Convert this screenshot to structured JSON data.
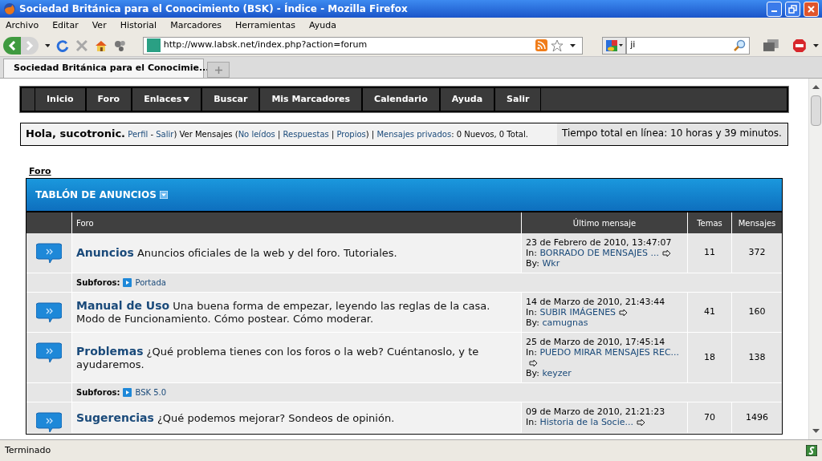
{
  "window": {
    "title": "Sociedad Británica para el Conocimiento (BSK) - Índice - Mozilla Firefox"
  },
  "menu": [
    "Archivo",
    "Editar",
    "Ver",
    "Historial",
    "Marcadores",
    "Herramientas",
    "Ayuda"
  ],
  "address": {
    "value": "http://www.labsk.net/index.php?action=forum"
  },
  "search": {
    "value": "ji"
  },
  "tabs": [
    {
      "label": "Sociedad Británica para el Conocimie...",
      "selected": true
    }
  ],
  "nav": [
    {
      "label": "Inicio",
      "has_menu": false
    },
    {
      "label": "Foro",
      "has_menu": false
    },
    {
      "label": "Enlaces",
      "has_menu": true
    },
    {
      "label": "Buscar",
      "has_menu": false
    },
    {
      "label": "Mis Marcadores",
      "has_menu": false
    },
    {
      "label": "Calendario",
      "has_menu": false
    },
    {
      "label": "Ayuda",
      "has_menu": false
    },
    {
      "label": "Salir",
      "has_menu": false
    }
  ],
  "user_box": {
    "greeting": "Hola, sucotronic.",
    "links_before": [
      {
        "text": "Perfil",
        "kind": "link"
      },
      {
        "text": " - ",
        "kind": "text"
      },
      {
        "text": "Salir",
        "kind": "link"
      },
      {
        "text": ") Ver Mensajes (",
        "kind": "text"
      },
      {
        "text": "No leídos",
        "kind": "link"
      },
      {
        "text": " | ",
        "kind": "text"
      },
      {
        "text": "Respuestas",
        "kind": "link"
      },
      {
        "text": " | ",
        "kind": "text"
      },
      {
        "text": "Propios",
        "kind": "link"
      },
      {
        "text": ") | ",
        "kind": "text"
      },
      {
        "text": "Mensajes privados",
        "kind": "link"
      },
      {
        "text": ": 0 Nuevos, 0 Total.",
        "kind": "text"
      }
    ],
    "online_time": "Tiempo total en línea: 10 horas y 39 minutos."
  },
  "breadcrumb": "Foro",
  "board": {
    "title": "TABLÓN DE ANUNCIOS",
    "columns": [
      "Foro",
      "Último mensaje",
      "Temas",
      "Mensajes"
    ],
    "rows": [
      {
        "kind": "forum",
        "name": "Anuncios",
        "description": "Anuncios oficiales de la web y del foro. Tutoriales.",
        "date": "23 de Febrero de 2010, 13:47:07",
        "in_label": "In:",
        "in_topic": "BORRADO DE MENSAJES ...",
        "by_label": "By:",
        "by_user": "Wkr",
        "topics": "11",
        "posts": "372"
      },
      {
        "kind": "subforums",
        "label": "Subforos:",
        "items": [
          "Portada"
        ]
      },
      {
        "kind": "forum",
        "name": "Manual de Uso",
        "description": "Una buena forma de empezar, leyendo las reglas de la casa. Modo de Funcionamiento. Cómo postear. Cómo moderar.",
        "date": "14 de Marzo de 2010, 21:43:44",
        "in_label": "In:",
        "in_topic": "SUBIR IMÁGENES",
        "by_label": "By:",
        "by_user": "camugnas",
        "topics": "41",
        "posts": "160"
      },
      {
        "kind": "forum",
        "name": "Problemas",
        "description": "¿Qué problema tienes con los foros o la web? Cuéntanoslo, y te ayudaremos.",
        "date": "25 de Marzo de 2010, 17:45:14",
        "in_label": "In:",
        "in_topic": "PUEDO MIRAR MENSAJES REC...",
        "by_label": "By:",
        "by_user": "keyzer",
        "topics": "18",
        "posts": "138"
      },
      {
        "kind": "subforums",
        "label": "Subforos:",
        "items": [
          "BSK 5.0"
        ]
      },
      {
        "kind": "forum",
        "name": "Sugerencias",
        "description": "¿Qué podemos mejorar? Sondeos de opinión.",
        "date": "09 de Marzo de 2010, 21:21:23",
        "in_label": "In:",
        "in_topic": "Historia de la Socie...",
        "topics": "70",
        "posts": "1496"
      }
    ]
  },
  "status_bar": {
    "text": "Terminado"
  }
}
